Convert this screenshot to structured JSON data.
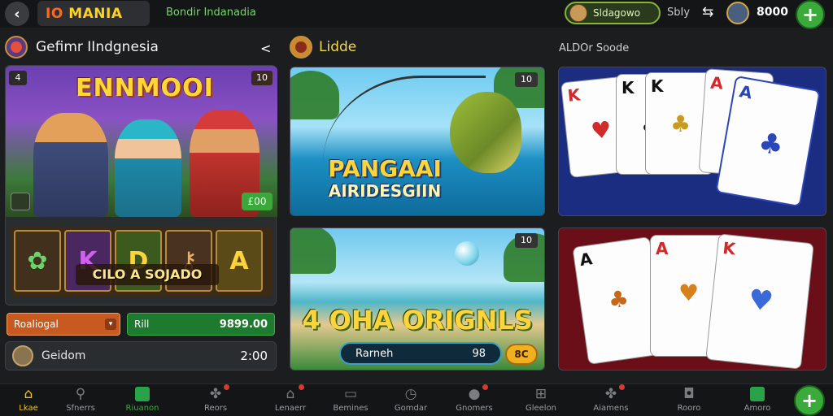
{
  "header": {
    "logo": "MANIA",
    "logo_prefix": "IO",
    "subtitle": "Bondir Indanadia",
    "user_name": "Sldagowo",
    "label_mid": "SbIy",
    "balance": "8000"
  },
  "sections": {
    "left_title": "Gefimr IIndgnesia",
    "middle_title": "Lidde",
    "right_title": "ALDOr Soode"
  },
  "left_game": {
    "title": "ENNMOOI",
    "badge_left": "4",
    "badge_right": "10",
    "price": "£00",
    "symbols": [
      "",
      "K",
      "D",
      "",
      "A"
    ],
    "banner": "CILO A SOJADO",
    "bet_label": "Roaliogal",
    "bet_amount_label": "Rill",
    "bet_amount_value": "9899.00",
    "info_label": "Geidom",
    "info_value": "2:00"
  },
  "middle_games": {
    "fish": {
      "title": "PANGAAI",
      "subtitle": "AIRIDESGIIN",
      "badge": "10"
    },
    "beach": {
      "title": "4 OHA ORIGNLS",
      "badge": "10",
      "search_label": "Rarneh",
      "search_value": "98",
      "coin_label": "8C"
    }
  },
  "right_games": {
    "blue_cards": [
      {
        "letter": "K",
        "suit": "♥",
        "color": "red"
      },
      {
        "letter": "K",
        "suit": "♣",
        "color": "black"
      },
      {
        "letter": "K",
        "suit": "♣",
        "color": "black"
      },
      {
        "letter": "A",
        "suit": "♥",
        "color": "red"
      },
      {
        "letter": "A",
        "suit": "♣",
        "color": "black"
      }
    ],
    "red_cards": [
      {
        "letter": "A",
        "suit": "♣",
        "color": "black"
      },
      {
        "letter": "A",
        "suit": "♥",
        "color": "red"
      },
      {
        "letter": "K",
        "suit": "♥",
        "color": "red"
      }
    ]
  },
  "bottom_nav": [
    {
      "label": "Lkae",
      "icon": "home-icon",
      "active": true
    },
    {
      "label": "Sfnerrs",
      "icon": "search-icon"
    },
    {
      "label": "Riuanon",
      "icon": "shop-icon"
    },
    {
      "label": "Reors",
      "icon": "puzzle-icon"
    },
    {
      "label": "Lenaerr",
      "icon": "house-icon"
    },
    {
      "label": "Bemines",
      "icon": "screen-icon"
    },
    {
      "label": "Gomdar",
      "icon": "clock-icon"
    },
    {
      "label": "Gnomers",
      "icon": "chat-icon"
    },
    {
      "label": "Gleelon",
      "icon": "grid-icon"
    },
    {
      "label": "Aiamens",
      "icon": "gift-icon"
    },
    {
      "label": "Rooro",
      "icon": "bag-icon"
    },
    {
      "label": "Amoro",
      "icon": "store-icon"
    }
  ],
  "colors": {
    "accent_gold": "#f2c224",
    "accent_green": "#3aab3a",
    "background": "#1b1d1f"
  }
}
